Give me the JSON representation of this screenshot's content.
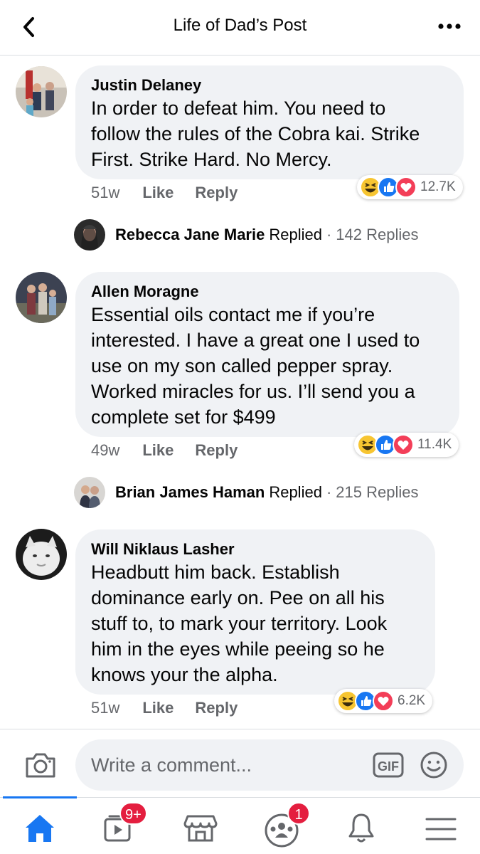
{
  "header": {
    "title": "Life of Dad’s Post",
    "back_icon": "chevron-left-icon",
    "more_icon": "more-dots-icon"
  },
  "comments": [
    {
      "author": "Justin Delaney",
      "text": "In order to defeat him. You need to\nfollow the rules of the Cobra kai. Strike\nFirst. Strike Hard. No Mercy.",
      "time": "51w",
      "like_label": "Like",
      "reply_label": "Reply",
      "reaction_count": "12.7K",
      "reply_preview": {
        "name": "Rebecca Jane Marie",
        "word": "Replied",
        "count": "142 Replies"
      }
    },
    {
      "author": "Allen Moragne",
      "text": "Essential oils contact me if you’re\ninterested. I have a great one I used to\nuse on my son called pepper spray.\nWorked miracles for us. I’ll send you a\ncomplete set for $499",
      "time": "49w",
      "like_label": "Like",
      "reply_label": "Reply",
      "reaction_count": "11.4K",
      "reply_preview": {
        "name": "Brian James Haman",
        "word": "Replied",
        "count": "215 Replies"
      }
    },
    {
      "author": "Will Niklaus Lasher",
      "text": "Headbutt him back. Establish\ndominance early on. Pee on all his\nstuff to, to mark your territory. Look\nhim in the eyes while peeing so he\nknows your the alpha.",
      "time": "51w",
      "like_label": "Like",
      "reply_label": "Reply",
      "reaction_count": "6.2K"
    }
  ],
  "composer": {
    "placeholder": "Write a comment...",
    "gif_label": "GIF"
  },
  "nav": {
    "video_badge": "9+",
    "groups_badge": "1"
  },
  "colors": {
    "accent": "#1877f2",
    "bubble": "#f0f2f5",
    "secondary_text": "#65676b",
    "badge": "#e41e3f"
  }
}
